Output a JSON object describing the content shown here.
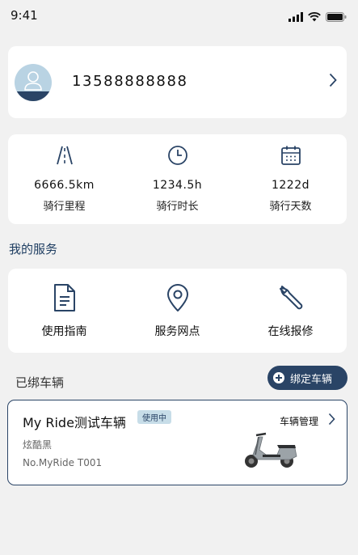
{
  "status_bar": {
    "time": "9:41"
  },
  "profile": {
    "phone": "13588888888"
  },
  "stats": [
    {
      "icon": "road-icon",
      "value": "6666.5km",
      "label": "骑行里程"
    },
    {
      "icon": "clock-icon",
      "value": "1234.5h",
      "label": "骑行时长"
    },
    {
      "icon": "calendar-icon",
      "value": "1222d",
      "label": "骑行天数"
    }
  ],
  "services": {
    "title": "我的服务",
    "items": [
      {
        "icon": "document-icon",
        "label": "使用指南"
      },
      {
        "icon": "location-pin-icon",
        "label": "服务网点"
      },
      {
        "icon": "wrench-icon",
        "label": "在线报修"
      }
    ]
  },
  "vehicles": {
    "title": "已绑车辆",
    "bind_button": "绑定车辆",
    "card": {
      "name": "My Ride测试车辆",
      "badge": "使用中",
      "color": "炫酷黑",
      "number": "No.MyRide T001",
      "manage": "车辆管理"
    }
  },
  "colors": {
    "accent": "#2a4466",
    "background": "#f1f1f1",
    "badge_bg": "#c7dde8"
  }
}
